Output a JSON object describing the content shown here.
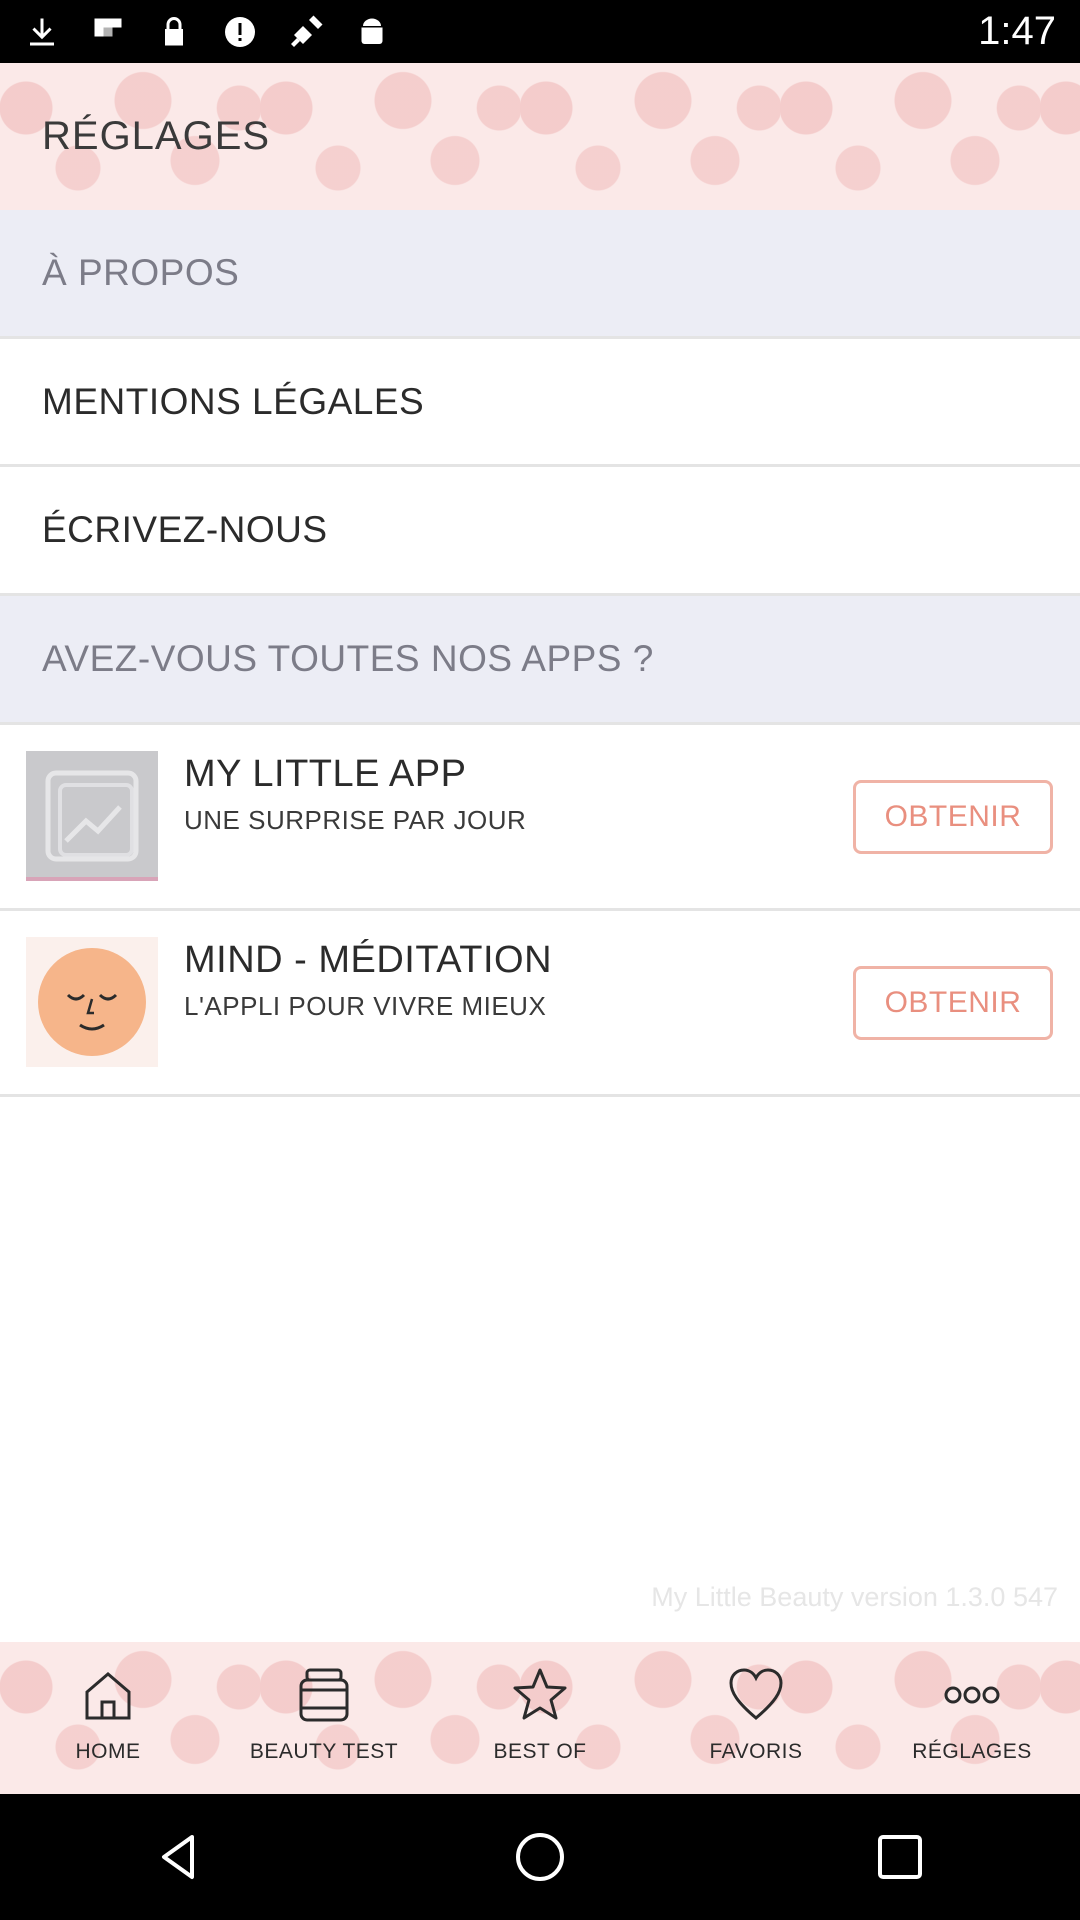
{
  "status_bar": {
    "time": "1:47",
    "icons": [
      "download-icon",
      "flipboard-icon",
      "lock-icon",
      "info-icon",
      "satellite-icon",
      "android-icon"
    ]
  },
  "header": {
    "title": "RÉGLAGES"
  },
  "menu": {
    "about": "À PROPOS",
    "legal": "MENTIONS LÉGALES",
    "contact": "ÉCRIVEZ-NOUS",
    "apps_section": "AVEZ-VOUS TOUTES NOS APPS ?"
  },
  "apps": [
    {
      "title": "MY LITTLE APP",
      "subtitle": "UNE SURPRISE PAR JOUR",
      "button": "OBTENIR",
      "icon": "image-placeholder-icon"
    },
    {
      "title": "MIND - MÉDITATION",
      "subtitle": "L'APPLI POUR VIVRE MIEUX",
      "button": "OBTENIR",
      "icon": "meditation-face-icon"
    }
  ],
  "version": "My Little Beauty version 1.3.0 547",
  "tabs": [
    {
      "label": "HOME",
      "icon": "home-icon"
    },
    {
      "label": "BEAUTY TEST",
      "icon": "jar-icon"
    },
    {
      "label": "BEST OF",
      "icon": "star-icon"
    },
    {
      "label": "FAVORIS",
      "icon": "heart-icon"
    },
    {
      "label": "RÉGLAGES",
      "icon": "more-dots-icon"
    }
  ],
  "colors": {
    "accent": "#e98f7f",
    "button_border": "#f0b3a6",
    "section_bg": "#ecedf5",
    "pattern_bg": "#fbe9e8"
  }
}
